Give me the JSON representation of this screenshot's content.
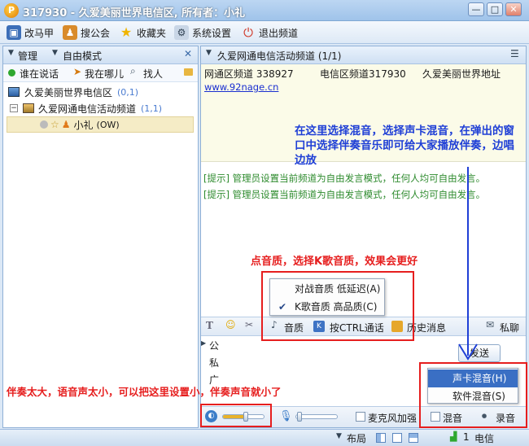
{
  "window": {
    "title": "317930 - 久爱美丽世界电信区, 所有者：小礼",
    "logo_glyph": "P",
    "btn_min": "—",
    "btn_max": "□",
    "btn_close": "✕"
  },
  "toolbar": {
    "items": [
      "改马甲",
      "搜公会",
      "收藏夹",
      "系统设置",
      "退出频道"
    ]
  },
  "left": {
    "tab_manage": "管理",
    "tab_mode": "自由模式",
    "close": "✕",
    "sub_talking": "谁在说话",
    "sub_where": "我在哪儿",
    "sub_find": "找人",
    "tree": {
      "root_name": "久爱美丽世界电信区",
      "root_count": "(0,1)",
      "child_name": "久爱网通电信活动频道",
      "child_count": "(1,1)",
      "user_name": "小礼",
      "user_tag": "(OW)"
    }
  },
  "right": {
    "header_title": "久爱网通电信活动频道 (1/1)",
    "notice_line1_a": "网通区频道  338927",
    "notice_line1_b": "电信区频道317930",
    "notice_line1_c": "久爱美丽世界地址",
    "notice_link": "www.92nage.cn",
    "sys_msg_1": "[提示] 管理员设置当前频道为自由发言模式，任何人均可自由发言。",
    "sys_msg_2": "[提示] 管理员设置当前频道为自由发言模式，任何人均可自由发言。",
    "ctrl": {
      "quality": "音质",
      "ctrl_talk": "按CTRL通话",
      "history": "历史消息",
      "private": "私聊"
    },
    "channel_tabs": [
      "公",
      "私",
      "广"
    ],
    "send_label": "发送",
    "bottom": {
      "mic_boost": "麦克风加强",
      "mix": "混音",
      "record": "录音"
    }
  },
  "quality_menu": {
    "item1": "对战音质  低延迟(A)",
    "item2": "K歌音质  高品质(C)",
    "checked": "✔"
  },
  "mix_menu": {
    "item1": "声卡混音(H)",
    "item2": "软件混音(S)"
  },
  "statusbar": {
    "layout": "布局",
    "signal": "1",
    "carrier": "电信"
  },
  "annotations": {
    "blue": "在这里选择混音，选择声卡混音，在弹出的窗口中选择伴奏音乐即可给大家播放伴奏，边唱边放",
    "red_top": "点音质，选择K歌音质，效果会更好",
    "red_bottom": "伴奏太大，语音声太小，可以把这里设置小，伴奏声音就小了"
  },
  "colors": {
    "annotation_red": "#e61e1e",
    "annotation_blue": "#1f3fd6",
    "system_msg": "#2e8b2e",
    "link": "#1a2fd0"
  }
}
